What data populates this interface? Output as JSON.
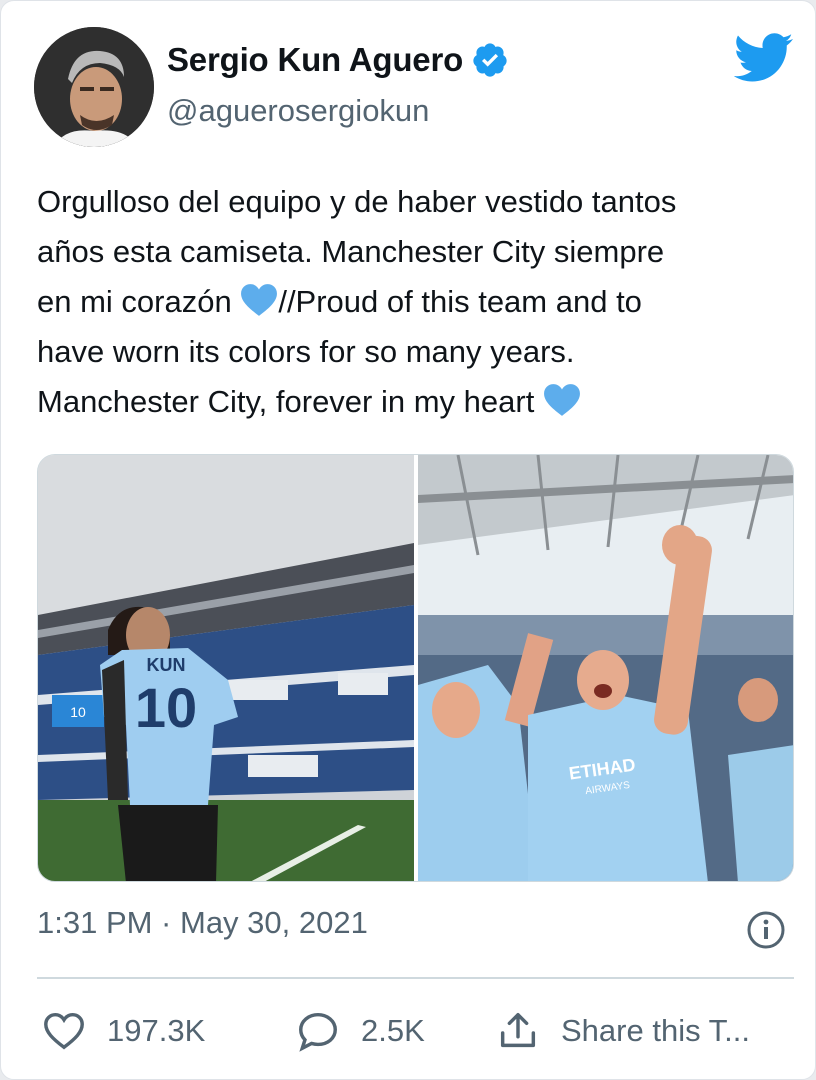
{
  "author": {
    "name": "Sergio Kun Aguero",
    "handle": "@aguerosergiokun",
    "verified": true
  },
  "tweet": {
    "line1": "Orgulloso del equipo y de haber vestido tantos",
    "line2": "años esta camiseta. Manchester City siempre",
    "line3_pre": "en mi corazón ",
    "line3_post": "//Proud of this team and to",
    "line4": "have worn its colors for so many years.",
    "line5": "Manchester City, forever in my heart ",
    "emoji": "blue-heart-icon"
  },
  "media": {
    "left": {
      "shirt_name": "KUN",
      "shirt_number": "10",
      "scoreboard_number": "10"
    },
    "right": {
      "shirt_sponsor": "ETIHAD",
      "shirt_sponsor_sub": "AIRWAYS"
    }
  },
  "meta": {
    "timestamp": "1:31 PM · May 30, 2021"
  },
  "actions": {
    "likes": "197.3K",
    "replies": "2.5K",
    "share_label": "Share this T..."
  },
  "colors": {
    "brand": "#1d9bf0",
    "heart": "#5dadec",
    "muted": "#536471",
    "city_blue": "#98c5e9"
  }
}
